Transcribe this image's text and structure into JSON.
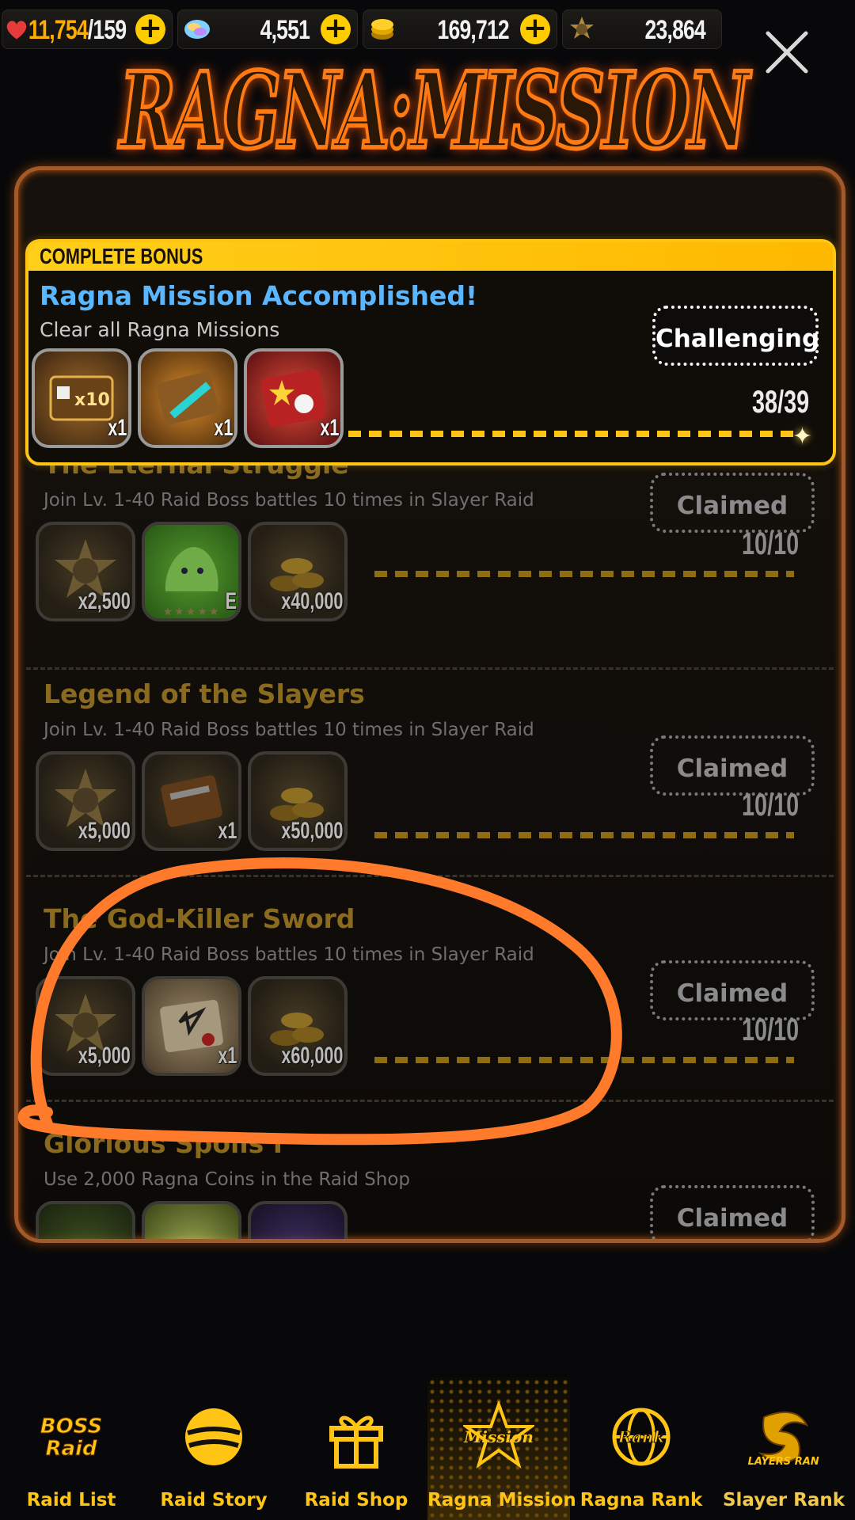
{
  "currencies": [
    {
      "name": "stamina-icon",
      "value": "11,754",
      "max": "/159",
      "has_plus": true
    },
    {
      "name": "rainbow-gem-icon",
      "value": "4,551",
      "has_plus": true
    },
    {
      "name": "gold-coin-icon",
      "value": "169,712",
      "has_plus": true
    },
    {
      "name": "ragna-coin-icon",
      "value": "23,864",
      "has_plus": false
    }
  ],
  "title": "RAGNA:MISSION",
  "complete_bonus": {
    "band_label": "COMPLETE BONUS",
    "title": "Ragna Mission Accomplished!",
    "description": "Clear all Ragna Missions",
    "status": "Challenging",
    "progress": "38/39",
    "progress_fraction": 0.974,
    "rewards": [
      {
        "icon": "gacha-ticket-x10-icon",
        "qty": "x1"
      },
      {
        "icon": "weapon-ticket-icon",
        "qty": "x1"
      },
      {
        "icon": "five-star-ticket-icon",
        "qty": "x1"
      }
    ]
  },
  "missions": [
    {
      "title": "The Eternal Struggle",
      "description": "Join Lv. 1-40 Raid Boss battles 10 times in Slayer Raid",
      "status": "Claimed",
      "progress": "10/10",
      "rewards": [
        {
          "icon": "ragna-medal-icon",
          "qty": "x2,500"
        },
        {
          "icon": "green-slime-icon",
          "qty": "E",
          "stars": "★★★★★"
        },
        {
          "icon": "gold-coins-icon",
          "qty": "x40,000"
        }
      ]
    },
    {
      "title": "Legend of the Slayers",
      "description": "Join Lv. 1-40 Raid Boss battles 10 times in Slayer Raid",
      "status": "Claimed",
      "progress": "10/10",
      "rewards": [
        {
          "icon": "ragna-medal-icon",
          "qty": "x5,000"
        },
        {
          "icon": "weapon-ticket-icon",
          "qty": "x1"
        },
        {
          "icon": "gold-coins-icon",
          "qty": "x50,000"
        }
      ]
    },
    {
      "title": "The God-Killer Sword",
      "description": "Join Lv. 1-40 Raid Boss battles 10 times in Slayer Raid",
      "status": "Claimed",
      "progress": "10/10",
      "rewards": [
        {
          "icon": "ragna-medal-icon",
          "qty": "x5,000"
        },
        {
          "icon": "goal-ticket-icon",
          "qty": "x1"
        },
        {
          "icon": "gold-coins-icon",
          "qty": "x60,000"
        }
      ]
    },
    {
      "title": "Glorious Spoils I",
      "description": "Use 2,000 Ragna Coins in the Raid Shop",
      "status": "Claimed",
      "progress": "",
      "rewards": []
    }
  ],
  "nav": [
    {
      "label": "Raid List",
      "icon": "boss-raid-icon",
      "active": false
    },
    {
      "label": "Raid Story",
      "icon": "raid-story-icon",
      "active": false
    },
    {
      "label": "Raid Shop",
      "icon": "gift-icon",
      "active": false
    },
    {
      "label": "Ragna Mission",
      "icon": "mission-star-icon",
      "active": true
    },
    {
      "label": "Ragna Rank",
      "icon": "rank-globe-icon",
      "active": false
    },
    {
      "label": "Slayer Rank",
      "icon": "slayers-rank-icon",
      "active": false
    }
  ],
  "colors": {
    "accent": "#ffc414",
    "frame": "#a3592a",
    "bonus_title": "#59b6ff",
    "annotation": "#ff7a2a"
  }
}
